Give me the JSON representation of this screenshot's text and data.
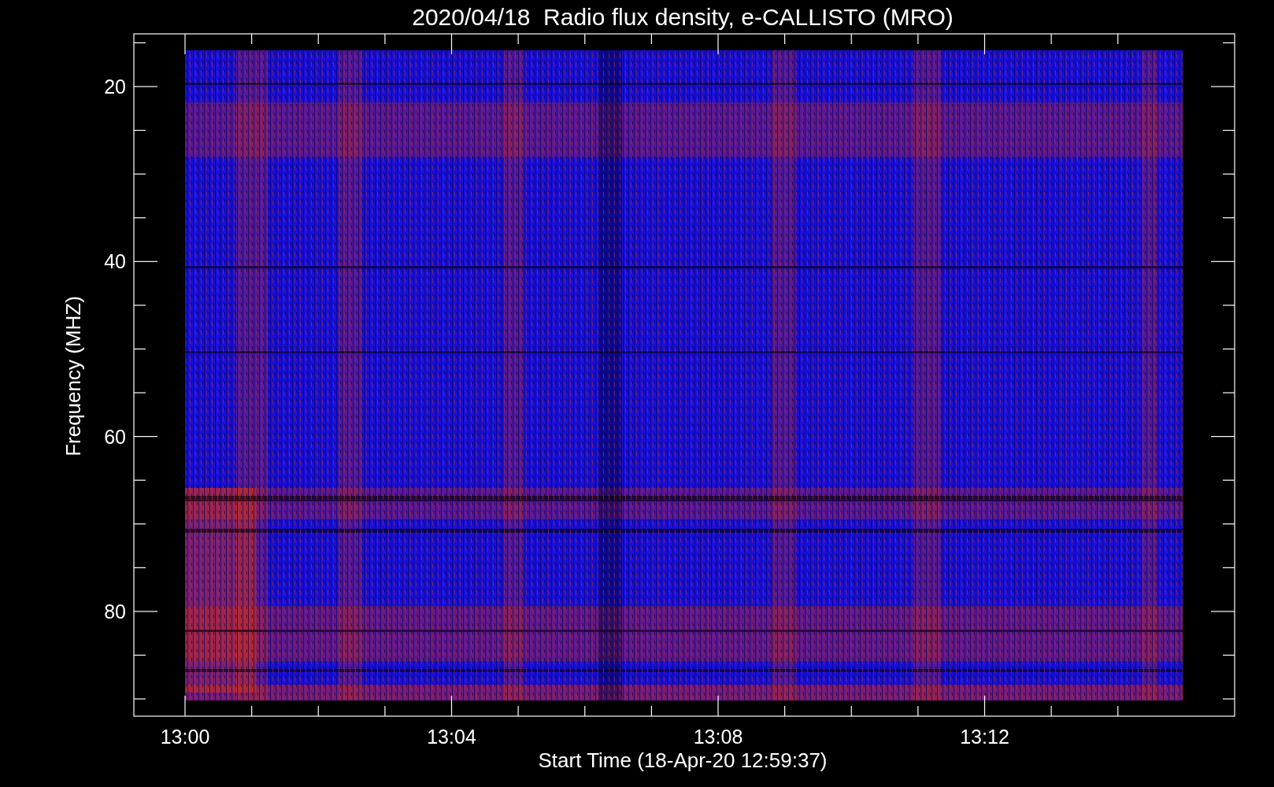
{
  "plot": {
    "title": "2020/04/18  Radio flux density, e-CALLISTO (MRO)",
    "xlabel": "Start Time (18-Apr-20 12:59:37)",
    "ylabel": "Frequency (MHZ)",
    "x_tick_labels": [
      "13:00",
      "13:04",
      "13:08",
      "13:12"
    ],
    "y_tick_labels": [
      "20",
      "40",
      "60",
      "80"
    ]
  }
}
